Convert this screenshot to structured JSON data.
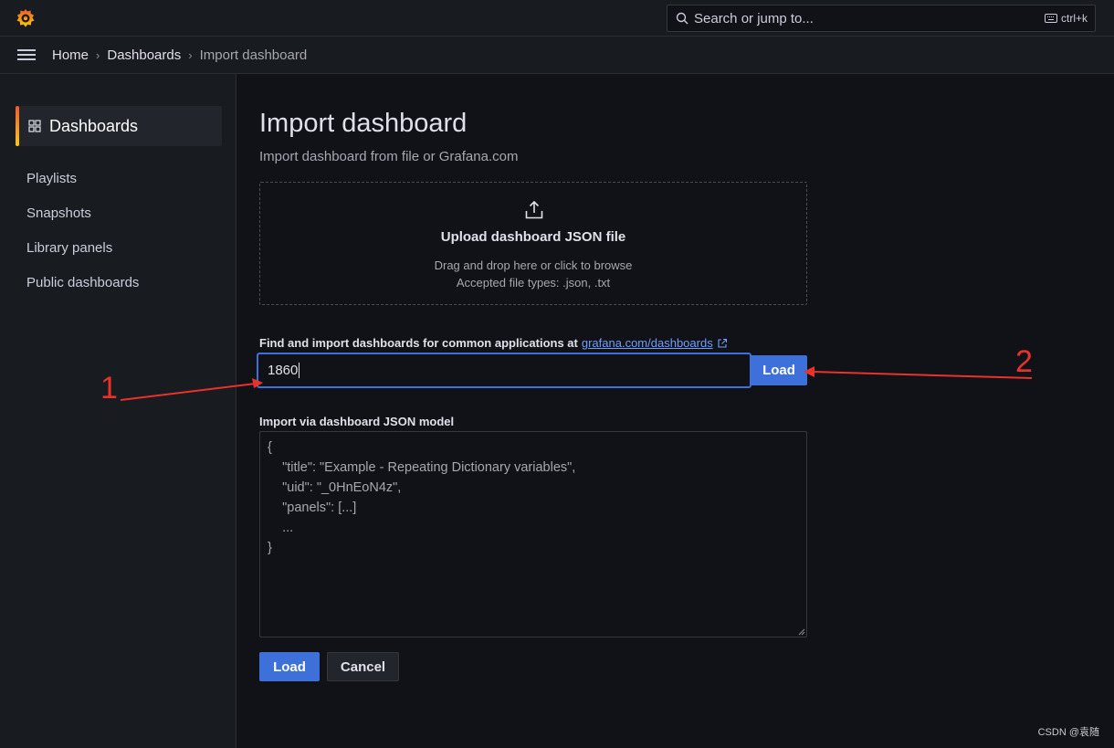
{
  "search": {
    "placeholder": "Search or jump to...",
    "shortcut": "ctrl+k"
  },
  "breadcrumb": {
    "home": "Home",
    "dashboards": "Dashboards",
    "current": "Import dashboard"
  },
  "sidebar": {
    "active": "Dashboards",
    "items": [
      "Playlists",
      "Snapshots",
      "Library panels",
      "Public dashboards"
    ]
  },
  "main": {
    "title": "Import dashboard",
    "subtitle": "Import dashboard from file or Grafana.com",
    "upload": {
      "title": "Upload dashboard JSON file",
      "hint": "Drag and drop here or click to browse",
      "types": "Accepted file types: .json, .txt"
    },
    "find": {
      "label": "Find and import dashboards for common applications at",
      "link": "grafana.com/dashboards",
      "value": "1860",
      "load_label": "Load"
    },
    "json_model": {
      "label": "Import via dashboard JSON model",
      "placeholder": "{\n    \"title\": \"Example - Repeating Dictionary variables\",\n    \"uid\": \"_0HnEoN4z\",\n    \"panels\": [...]\n    ...\n}"
    },
    "buttons": {
      "load": "Load",
      "cancel": "Cancel"
    }
  },
  "annotations": {
    "one": "1",
    "two": "2"
  },
  "colors": {
    "accent": "#3d71d9",
    "annotation": "#e8322a",
    "background": "#111217"
  },
  "watermark": "CSDN @袁随"
}
